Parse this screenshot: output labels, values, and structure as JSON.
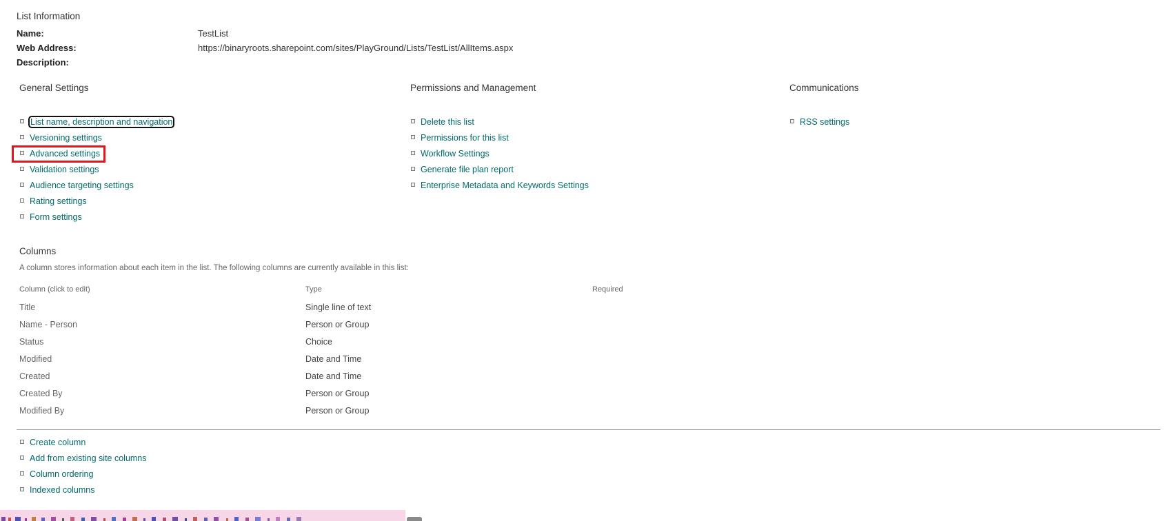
{
  "list_info": {
    "title": "List Information",
    "name_label": "Name:",
    "name_value": "TestList",
    "web_address_label": "Web Address:",
    "web_address_value": "https://binaryroots.sharepoint.com/sites/PlayGround/Lists/TestList/AllItems.aspx",
    "description_label": "Description:",
    "description_value": ""
  },
  "general_settings": {
    "title": "General Settings",
    "links": [
      "List name, description and navigation",
      "Versioning settings",
      "Advanced settings",
      "Validation settings",
      "Audience targeting settings",
      "Rating settings",
      "Form settings"
    ]
  },
  "permissions_management": {
    "title": "Permissions and Management",
    "links": [
      "Delete this list",
      "Permissions for this list",
      "Workflow Settings",
      "Generate file plan report",
      "Enterprise Metadata and Keywords Settings"
    ]
  },
  "communications": {
    "title": "Communications",
    "links": [
      "RSS settings"
    ]
  },
  "columns": {
    "title": "Columns",
    "description": "A column stores information about each item in the list. The following columns are currently available in this list:",
    "headers": {
      "column": "Column (click to edit)",
      "type": "Type",
      "required": "Required"
    },
    "rows": [
      {
        "name": "Title",
        "type": "Single line of text"
      },
      {
        "name": "Name - Person",
        "type": "Person or Group"
      },
      {
        "name": "Status",
        "type": "Choice"
      },
      {
        "name": "Modified",
        "type": "Date and Time"
      },
      {
        "name": "Created",
        "type": "Date and Time"
      },
      {
        "name": "Created By",
        "type": "Person or Group"
      },
      {
        "name": "Modified By",
        "type": "Person or Group"
      }
    ],
    "actions": [
      "Create column",
      "Add from existing site columns",
      "Column ordering",
      "Indexed columns"
    ]
  },
  "colors": {
    "link": "#036a6a",
    "highlight": "#e3151a"
  }
}
